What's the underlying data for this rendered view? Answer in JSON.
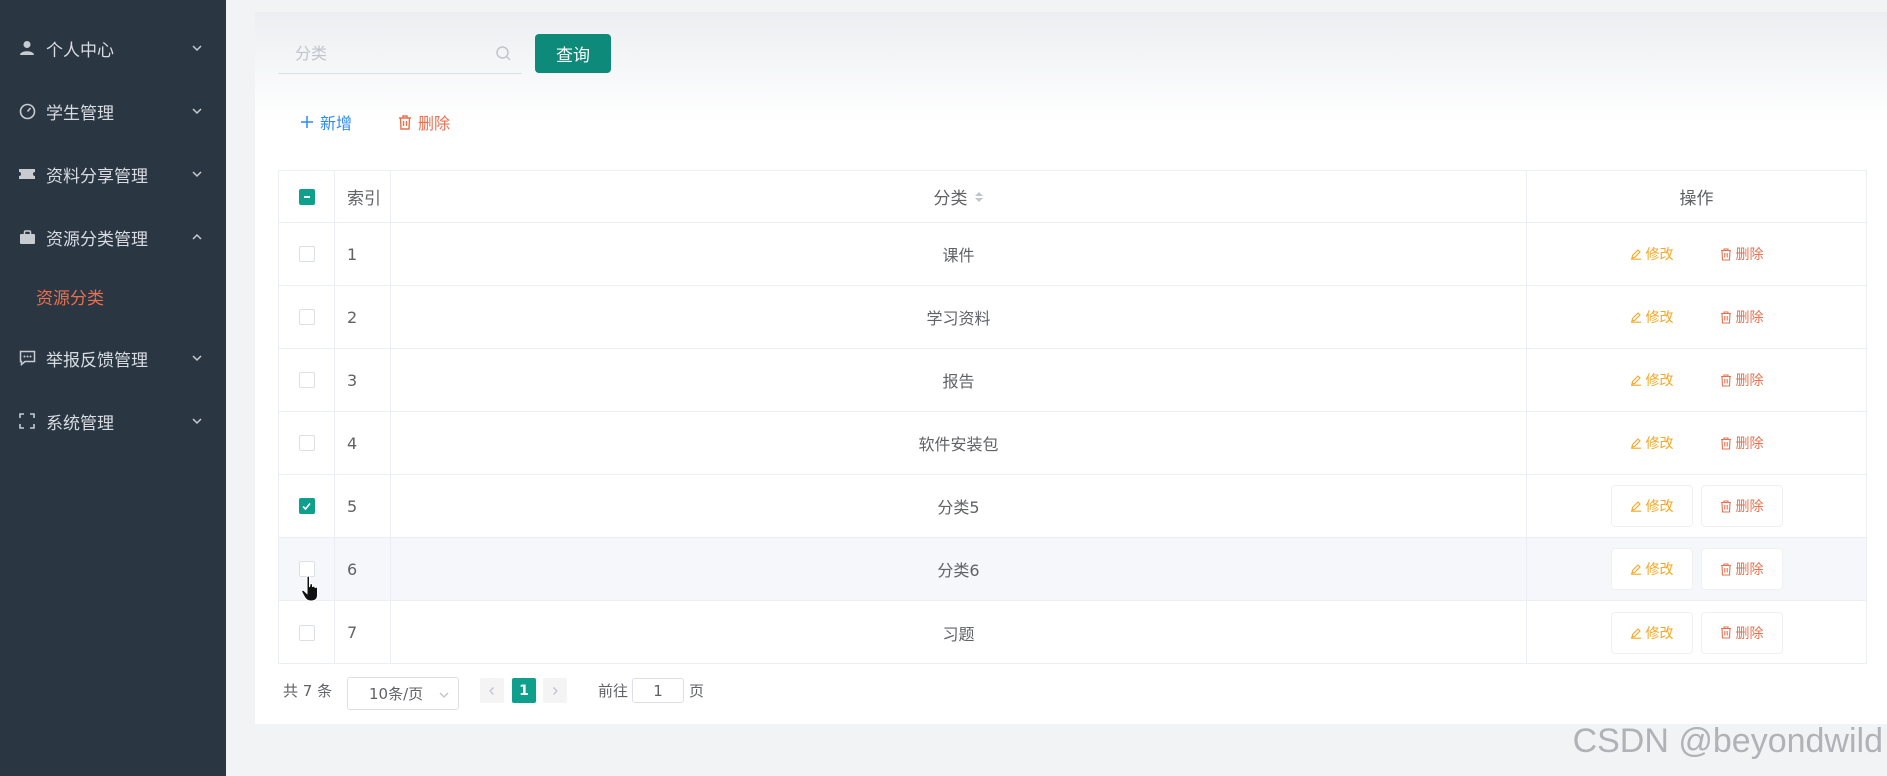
{
  "sidebar": {
    "items": [
      {
        "label": "个人中心",
        "icon": "user-icon",
        "expanded": false
      },
      {
        "label": "学生管理",
        "icon": "gauge-icon",
        "expanded": false
      },
      {
        "label": "资料分享管理",
        "icon": "ticket-icon",
        "expanded": false
      },
      {
        "label": "资源分类管理",
        "icon": "briefcase-icon",
        "expanded": true
      },
      {
        "label": "举报反馈管理",
        "icon": "chat-icon",
        "expanded": false
      },
      {
        "label": "系统管理",
        "icon": "fullscreen-icon",
        "expanded": false
      }
    ],
    "active_sub": "资源分类"
  },
  "search": {
    "placeholder": "分类",
    "value": "",
    "button_label": "查询"
  },
  "toolbar": {
    "add_label": "新增",
    "delete_label": "删除"
  },
  "table": {
    "headers": {
      "index": "索引",
      "category": "分类",
      "actions": "操作"
    },
    "edit_label": "修改",
    "delete_label": "删除",
    "rows": [
      {
        "index": "1",
        "category": "课件",
        "checked": false
      },
      {
        "index": "2",
        "category": "学习资料",
        "checked": false
      },
      {
        "index": "3",
        "category": "报告",
        "checked": false
      },
      {
        "index": "4",
        "category": "软件安装包",
        "checked": false
      },
      {
        "index": "5",
        "category": "分类5",
        "checked": true
      },
      {
        "index": "6",
        "category": "分类6",
        "checked": false
      },
      {
        "index": "7",
        "category": "习题",
        "checked": false
      }
    ]
  },
  "pagination": {
    "total_text": "共 7 条",
    "page_size": "10条/页",
    "current_page": "1",
    "goto_label": "前往",
    "goto_value": "1",
    "page_suffix": "页"
  },
  "watermark": "CSDN @beyondwild",
  "colors": {
    "sidebar_bg": "#2b3643",
    "accent": "#0fa08d",
    "active_sub": "#e8704e",
    "edit": "#f5a623",
    "delete": "#e8704e",
    "add": "#2d8cf0"
  }
}
